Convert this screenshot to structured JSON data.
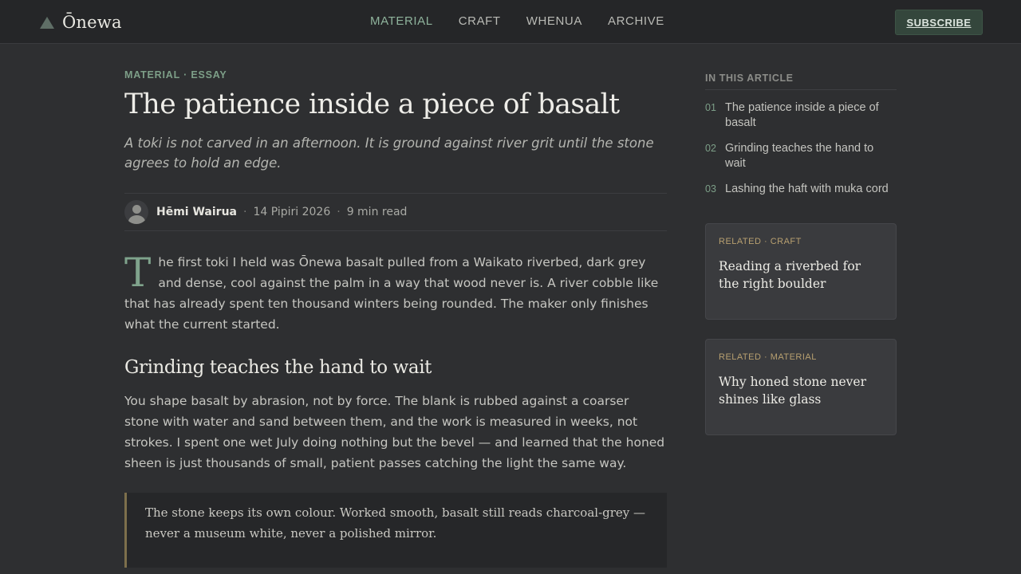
{
  "header": {
    "brand": "Ōnewa",
    "nav": [
      "MATERIAL",
      "CRAFT",
      "WHENUA",
      "ARCHIVE"
    ],
    "active_nav": "MATERIAL",
    "subscribe_label": "SUBSCRIBE"
  },
  "article": {
    "kicker": "MATERIAL · ESSAY",
    "title": "The patience inside a piece of basalt",
    "dek": "A toki is not carved in an afternoon. It is ground against river grit until the stone agrees to hold an edge.",
    "author": "Hēmi Wairua",
    "date": "14 Pipiri 2026",
    "read_time": "9 min read",
    "separator": "·",
    "lead_dropcap": "T",
    "lead_rest": "he first toki I held was Ōnewa basalt pulled from a Waikato riverbed, dark grey and dense, cool against the palm in a way that wood never is. A river cobble like that has already spent ten thousand winters being rounded. The maker only finishes what the current started.",
    "section_heading": "Grinding teaches the hand to wait",
    "section_body": "You shape basalt by abrasion, not by force. The blank is rubbed against a coarser stone with water and sand between them, and the work is measured in weeks, not strokes. I spent one wet July doing nothing but the bevel — and learned that the honed sheen is just thousands of small, patient passes catching the light the same way.",
    "pullquote": "The stone keeps its own colour. Worked smooth, basalt still reads charcoal-grey — never a museum white, never a polished mirror."
  },
  "toc": {
    "heading": "IN THIS ARTICLE",
    "items": [
      {
        "num": "01",
        "label": "The patience inside a piece of basalt"
      },
      {
        "num": "02",
        "label": "Grinding teaches the hand to wait"
      },
      {
        "num": "03",
        "label": "Lashing the haft with muka cord"
      }
    ]
  },
  "related": [
    {
      "kicker": "RELATED · CRAFT",
      "title": "Reading a riverbed for the right boulder"
    },
    {
      "kicker": "RELATED · MATERIAL",
      "title": "Why honed stone never shines like glass"
    }
  ],
  "colors": {
    "background": "#2e2f31",
    "accent": "#7d9f88",
    "related_kicker": "#b8a070"
  },
  "icons": {
    "brand": "triangle-logo-icon",
    "avatar": "user-avatar-icon"
  }
}
